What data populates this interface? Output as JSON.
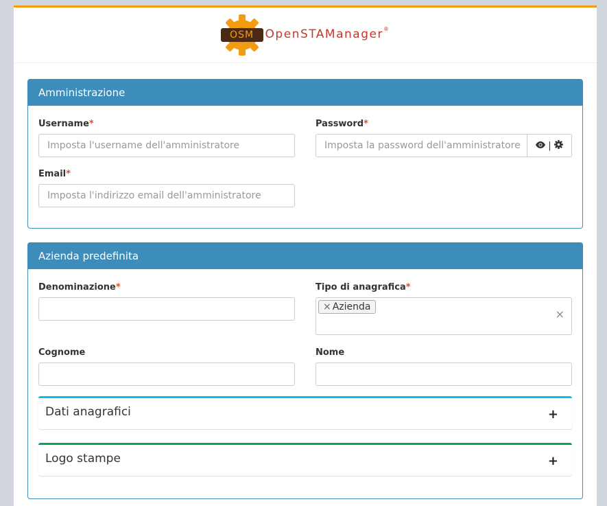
{
  "logo": {
    "badge": "OSM",
    "brand": "OpenSTAManager",
    "registered": "®"
  },
  "admin": {
    "title": "Amministrazione",
    "username_label": "Username",
    "username_placeholder": "Imposta l'username dell'amministratore",
    "password_label": "Password",
    "password_placeholder": "Imposta la password dell'amministratore",
    "email_label": "Email",
    "email_placeholder": "Imposta l'indirizzo email dell'amministratore",
    "addon_separator": "|"
  },
  "company": {
    "title": "Azienda predefinita",
    "denominazione_label": "Denominazione",
    "tipo_label": "Tipo di anagrafica",
    "tipo_tag": "Azienda",
    "cognome_label": "Cognome",
    "nome_label": "Nome",
    "dati_title": "Dati anagrafici",
    "logo_title": "Logo stampe"
  },
  "required_mark": "*",
  "icons": {
    "tag_remove": "×",
    "clear": "×",
    "expand": "+"
  },
  "colors": {
    "primary": "#3c8dbc",
    "accent_top": "#f39c12",
    "info": "#00c0ef",
    "success": "#00a65a",
    "required": "#dd4b39",
    "brand": "#c0392b"
  }
}
